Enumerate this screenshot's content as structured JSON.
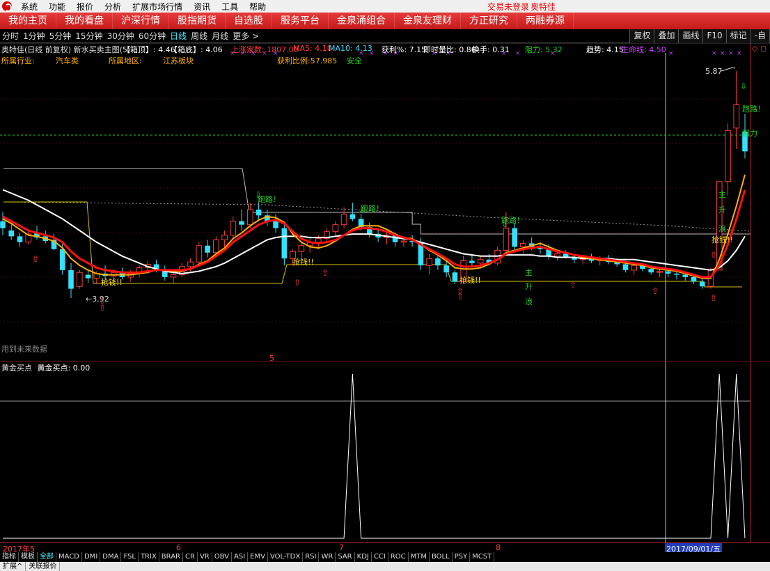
{
  "menu": {
    "items": [
      "系统",
      "功能",
      "报价",
      "分析",
      "扩展市场行情",
      "资讯",
      "工具",
      "帮助"
    ],
    "status": "交易未登录",
    "stock": "奥特佳"
  },
  "nav": {
    "items": [
      "我的主页",
      "我的看盘",
      "沪深行情",
      "股指期货",
      "自选股",
      "服务平台",
      "金泉涌组合",
      "金泉友理财",
      "方正研究",
      "两融券源"
    ]
  },
  "periods": {
    "items": [
      "分时",
      "1分钟",
      "5分钟",
      "15分钟",
      "30分钟",
      "60分钟",
      "日线",
      "周线",
      "月线",
      "更多 >"
    ],
    "selected": "日线",
    "right_buttons": [
      "复权",
      "叠加",
      "画线",
      "F10",
      "标记",
      "-自"
    ]
  },
  "info": {
    "title": "奥特佳(日线 前复权) 新水买卖主图(5)",
    "box_top": "【箱顶】: 4.46",
    "box_bottom": "【箱底】: 4.06",
    "limit_up": "上涨家数: 1807.00",
    "ma5": "MA5: 4.10",
    "ma10": "MA10: 4.13",
    "profit_pct": "获利%: 7.15",
    "vol_ratio": "即时量比: 0.86",
    "turnover": "换手: 0.31",
    "resistance": "阻力: 5.32",
    "trend": "趋势: 4.15",
    "lifeline": "生命线: 4.50",
    "industry_label": "所属行业:",
    "industry": "汽车类",
    "region_label": "所属地区:",
    "region": "江苏板块",
    "profit_ratio": "获利比例:57.985",
    "safety": "安全"
  },
  "annotations": {
    "high_price": "5.87",
    "low_price": "3.92",
    "run": "跑路！",
    "catch": "抢钱!!",
    "resist": "阻力",
    "main_up_wave": [
      "主",
      "升",
      "浪"
    ],
    "future_data": "用到未来数据",
    "red_5": "5"
  },
  "sub": {
    "title": "黄金买点",
    "value_label": "黄金买点: 0.00"
  },
  "xaxis": {
    "labels": [
      "2017年5",
      "6",
      "7",
      "8"
    ],
    "cursor_date": "2017/09/01/五"
  },
  "tabs": [
    "指标",
    "模板",
    "全部",
    "MACD",
    "DMI",
    "DMA",
    "FSL",
    "TRIX",
    "BRAR",
    "CR",
    "VR",
    "OBV",
    "ASI",
    "EMV",
    "VOL-TDX",
    "RSI",
    "WR",
    "SAR",
    "KDJ",
    "CCI",
    "ROC",
    "MTM",
    "BOLL",
    "PSY",
    "MCST"
  ],
  "tabs_selected": "全部",
  "footer": [
    "扩展^",
    "关联报价"
  ],
  "colors": {
    "up": "#ff3b3b",
    "down": "#33e0ff",
    "ma_yellow": "#ffb000",
    "ma_red": "#ff1010",
    "ma_white": "#ffffff",
    "signal_green": "#22cc22"
  },
  "chart_data": {
    "type": "candlestick",
    "ylabel": "",
    "candles": [
      [
        4.58,
        4.66,
        4.46,
        4.52
      ],
      [
        4.5,
        4.55,
        4.42,
        4.45
      ],
      [
        4.45,
        4.48,
        4.36,
        4.4
      ],
      [
        4.4,
        4.5,
        4.38,
        4.47
      ],
      [
        4.48,
        4.54,
        4.42,
        4.44
      ],
      [
        4.45,
        4.5,
        4.39,
        4.41
      ],
      [
        4.42,
        4.47,
        4.33,
        4.34
      ],
      [
        4.34,
        4.4,
        4.12,
        4.16
      ],
      [
        4.16,
        4.22,
        3.92,
        4.0
      ],
      [
        4.02,
        4.16,
        4.0,
        4.14
      ],
      [
        4.12,
        4.16,
        4.05,
        4.09
      ],
      [
        4.09,
        4.15,
        4.04,
        4.13
      ],
      [
        4.13,
        4.2,
        4.08,
        4.11
      ],
      [
        4.11,
        4.17,
        4.06,
        4.14
      ],
      [
        4.14,
        4.18,
        4.08,
        4.1
      ],
      [
        4.1,
        4.16,
        4.06,
        4.13
      ],
      [
        4.13,
        4.2,
        4.1,
        4.18
      ],
      [
        4.18,
        4.24,
        4.13,
        4.21
      ],
      [
        4.21,
        4.25,
        4.14,
        4.16
      ],
      [
        4.16,
        4.2,
        4.07,
        4.1
      ],
      [
        4.1,
        4.14,
        4.05,
        4.12
      ],
      [
        4.12,
        4.22,
        4.1,
        4.19
      ],
      [
        4.19,
        4.26,
        4.15,
        4.23
      ],
      [
        4.23,
        4.4,
        4.2,
        4.37
      ],
      [
        4.37,
        4.42,
        4.27,
        4.31
      ],
      [
        4.31,
        4.45,
        4.28,
        4.42
      ],
      [
        4.42,
        4.5,
        4.36,
        4.46
      ],
      [
        4.46,
        4.62,
        4.43,
        4.58
      ],
      [
        4.58,
        4.68,
        4.5,
        4.55
      ],
      [
        4.55,
        4.74,
        4.52,
        4.68
      ],
      [
        4.68,
        4.74,
        4.58,
        4.63
      ],
      [
        4.63,
        4.68,
        4.54,
        4.58
      ],
      [
        4.58,
        4.64,
        4.48,
        4.52
      ],
      [
        4.52,
        4.56,
        4.2,
        4.26
      ],
      [
        4.26,
        4.34,
        4.2,
        4.32
      ],
      [
        4.32,
        4.4,
        4.26,
        4.37
      ],
      [
        4.37,
        4.44,
        4.31,
        4.4
      ],
      [
        4.4,
        4.46,
        4.34,
        4.43
      ],
      [
        4.43,
        4.52,
        4.4,
        4.49
      ],
      [
        4.49,
        4.58,
        4.45,
        4.55
      ],
      [
        4.55,
        4.7,
        4.52,
        4.64
      ],
      [
        4.64,
        4.74,
        4.58,
        4.6
      ],
      [
        4.6,
        4.64,
        4.5,
        4.53
      ],
      [
        4.53,
        4.57,
        4.44,
        4.47
      ],
      [
        4.47,
        4.52,
        4.4,
        4.44
      ],
      [
        4.44,
        4.5,
        4.38,
        4.46
      ],
      [
        4.46,
        4.48,
        4.36,
        4.4
      ],
      [
        4.4,
        4.44,
        4.36,
        4.41
      ],
      [
        4.41,
        4.46,
        4.36,
        4.4
      ],
      [
        4.4,
        4.44,
        4.16,
        4.2
      ],
      [
        4.2,
        4.3,
        4.12,
        4.26
      ],
      [
        4.26,
        4.3,
        4.16,
        4.2
      ],
      [
        4.2,
        4.24,
        4.1,
        4.14
      ],
      [
        4.14,
        4.16,
        4.04,
        4.06
      ],
      [
        4.06,
        4.28,
        4.04,
        4.24
      ],
      [
        4.24,
        4.3,
        4.18,
        4.22
      ],
      [
        4.22,
        4.28,
        4.18,
        4.25
      ],
      [
        4.25,
        4.3,
        4.2,
        4.22
      ],
      [
        4.22,
        4.36,
        4.2,
        4.33
      ],
      [
        4.33,
        4.66,
        4.3,
        4.52
      ],
      [
        4.52,
        4.56,
        4.34,
        4.36
      ],
      [
        4.36,
        4.42,
        4.3,
        4.39
      ],
      [
        4.39,
        4.44,
        4.33,
        4.36
      ],
      [
        4.36,
        4.4,
        4.3,
        4.34
      ],
      [
        4.34,
        4.38,
        4.25,
        4.28
      ],
      [
        4.28,
        4.32,
        4.24,
        4.3
      ],
      [
        4.3,
        4.33,
        4.26,
        4.27
      ],
      [
        4.27,
        4.3,
        4.22,
        4.25
      ],
      [
        4.25,
        4.29,
        4.21,
        4.27
      ],
      [
        4.27,
        4.3,
        4.22,
        4.24
      ],
      [
        4.24,
        4.28,
        4.2,
        4.26
      ],
      [
        4.26,
        4.29,
        4.21,
        4.23
      ],
      [
        4.23,
        4.26,
        4.19,
        4.21
      ],
      [
        4.21,
        4.24,
        4.14,
        4.16
      ],
      [
        4.16,
        4.22,
        4.12,
        4.2
      ],
      [
        4.2,
        4.22,
        4.15,
        4.17
      ],
      [
        4.17,
        4.2,
        4.12,
        4.14
      ],
      [
        4.14,
        4.17,
        4.1,
        4.15
      ],
      [
        4.15,
        4.18,
        4.1,
        4.13
      ],
      [
        4.13,
        4.16,
        4.08,
        4.12
      ],
      [
        4.12,
        4.15,
        4.07,
        4.1
      ],
      [
        4.1,
        4.13,
        4.04,
        4.06
      ],
      [
        4.06,
        4.1,
        4.0,
        4.02
      ],
      [
        4.02,
        4.18,
        4.0,
        4.16
      ],
      [
        4.16,
        4.92,
        4.16,
        4.92
      ],
      [
        4.92,
        5.42,
        4.8,
        5.36
      ],
      [
        5.38,
        5.87,
        5.2,
        5.58
      ],
      [
        5.35,
        5.5,
        5.12,
        5.18
      ]
    ],
    "ma_yellow": [
      4.6,
      4.56,
      4.51,
      4.46,
      4.45,
      4.43,
      4.41,
      4.35,
      4.26,
      4.2,
      4.16,
      4.13,
      4.12,
      4.12,
      4.12,
      4.12,
      4.13,
      4.14,
      4.16,
      4.16,
      4.15,
      4.15,
      4.17,
      4.21,
      4.24,
      4.3,
      4.35,
      4.43,
      4.48,
      4.54,
      4.59,
      4.62,
      4.61,
      4.57,
      4.47,
      4.4,
      4.36,
      4.35,
      4.37,
      4.41,
      4.46,
      4.51,
      4.54,
      4.54,
      4.54,
      4.51,
      4.47,
      4.44,
      4.43,
      4.38,
      4.33,
      4.29,
      4.24,
      4.18,
      4.17,
      4.17,
      4.18,
      4.21,
      4.25,
      4.31,
      4.33,
      4.35,
      4.37,
      4.39,
      4.36,
      4.33,
      4.31,
      4.29,
      4.27,
      4.26,
      4.25,
      4.24,
      4.23,
      4.22,
      4.21,
      4.2,
      4.18,
      4.17,
      4.16,
      4.15,
      4.13,
      4.11,
      4.09,
      4.09,
      4.25,
      4.47,
      4.71,
      4.98
    ],
    "ma_red": [
      4.62,
      4.58,
      4.54,
      4.5,
      4.48,
      4.46,
      4.44,
      4.4,
      4.32,
      4.26,
      4.22,
      4.18,
      4.16,
      4.15,
      4.14,
      4.14,
      4.14,
      4.15,
      4.16,
      4.16,
      4.16,
      4.16,
      4.17,
      4.2,
      4.23,
      4.28,
      4.33,
      4.4,
      4.45,
      4.5,
      4.55,
      4.58,
      4.59,
      4.56,
      4.49,
      4.43,
      4.4,
      4.39,
      4.4,
      4.42,
      4.46,
      4.5,
      4.52,
      4.52,
      4.51,
      4.49,
      4.46,
      4.44,
      4.42,
      4.38,
      4.34,
      4.3,
      4.26,
      4.21,
      4.19,
      4.19,
      4.2,
      4.22,
      4.25,
      4.3,
      4.32,
      4.34,
      4.35,
      4.36,
      4.34,
      4.32,
      4.31,
      4.29,
      4.28,
      4.27,
      4.26,
      4.25,
      4.24,
      4.23,
      4.22,
      4.21,
      4.19,
      4.18,
      4.17,
      4.16,
      4.14,
      4.12,
      4.1,
      4.1,
      4.2,
      4.38,
      4.6,
      4.85
    ],
    "ma_white": [
      4.85,
      4.82,
      4.79,
      4.76,
      4.72,
      4.68,
      4.64,
      4.6,
      4.55,
      4.5,
      4.45,
      4.4,
      4.36,
      4.32,
      4.28,
      4.25,
      4.22,
      4.19,
      4.17,
      4.15,
      4.14,
      4.13,
      4.14,
      4.15,
      4.17,
      4.19,
      4.22,
      4.26,
      4.3,
      4.34,
      4.38,
      4.42,
      4.44,
      4.45,
      4.45,
      4.45,
      4.44,
      4.44,
      4.44,
      4.45,
      4.46,
      4.47,
      4.47,
      4.47,
      4.46,
      4.45,
      4.44,
      4.43,
      4.42,
      4.4,
      4.38,
      4.36,
      4.34,
      4.32,
      4.3,
      4.29,
      4.28,
      4.28,
      4.28,
      4.29,
      4.29,
      4.29,
      4.29,
      4.28,
      4.28,
      4.27,
      4.27,
      4.27,
      4.26,
      4.26,
      4.26,
      4.26,
      4.25,
      4.25,
      4.25,
      4.24,
      4.23,
      4.22,
      4.21,
      4.2,
      4.19,
      4.18,
      4.17,
      4.16,
      4.18,
      4.24,
      4.33,
      4.45
    ],
    "signal": [
      0,
      0,
      0,
      0,
      0,
      0,
      0,
      0,
      0,
      0,
      0,
      0,
      0,
      0,
      0,
      0,
      0,
      0,
      0,
      0,
      0,
      0,
      0,
      0,
      0,
      0,
      0,
      0,
      0,
      0,
      0,
      0,
      0,
      0,
      0,
      0,
      0,
      0,
      0,
      0,
      0,
      1,
      0,
      0,
      0,
      0,
      0,
      0,
      0,
      0,
      0,
      0,
      0,
      0,
      0,
      0,
      0,
      0,
      0,
      0,
      0,
      0,
      0,
      0,
      0,
      0,
      0,
      0,
      0,
      0,
      0,
      0,
      0,
      0,
      0,
      0,
      0,
      0,
      0,
      0,
      0,
      0,
      0,
      0,
      1,
      0,
      1,
      0
    ]
  }
}
